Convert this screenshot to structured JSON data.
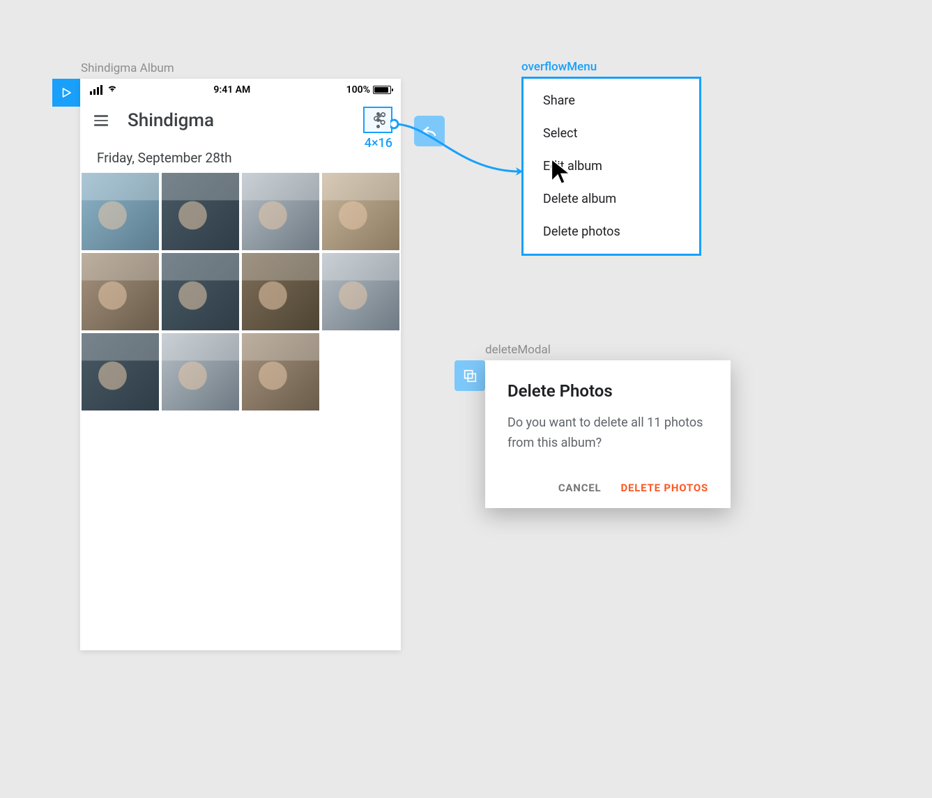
{
  "labels": {
    "albumFrame": "Shindigma Album",
    "overflowFrame": "overflowMenu",
    "deleteFrame": "deleteModal"
  },
  "statusBar": {
    "time": "9:41 AM",
    "batteryText": "100%"
  },
  "appBar": {
    "title": "Shindigma"
  },
  "selectionSize": "4×16",
  "dateHeader": "Friday, September 28th",
  "photoThumbs": [
    "c1",
    "c2",
    "c3",
    "c4",
    "c5",
    "c2",
    "c6",
    "c3",
    "c2",
    "c3",
    "c5"
  ],
  "overflowMenu": {
    "items": [
      "Share",
      "Select",
      "Edit album",
      "Delete album",
      "Delete photos"
    ]
  },
  "deleteModal": {
    "title": "Delete Photos",
    "body": "Do you want to delete all 11 photos from this album?",
    "cancel": "CANCEL",
    "confirm": "DELETE PHOTOS"
  }
}
